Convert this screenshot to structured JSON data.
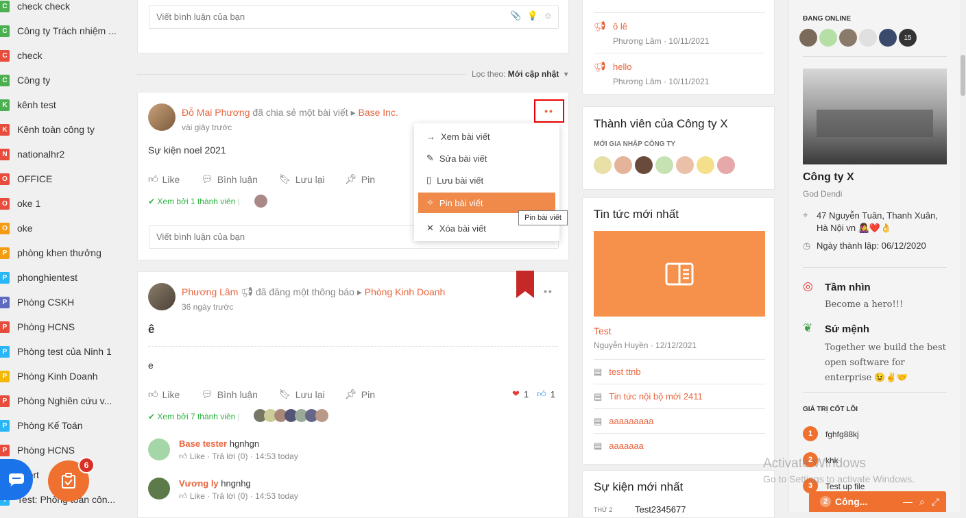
{
  "sidebar": {
    "items": [
      {
        "badge": "C",
        "color": "#4caf50",
        "label": "check check"
      },
      {
        "badge": "C",
        "color": "#4caf50",
        "label": "Công ty Trách nhiệm ..."
      },
      {
        "badge": "C",
        "color": "#e74c3c",
        "label": "check"
      },
      {
        "badge": "C",
        "color": "#4caf50",
        "label": "Công ty"
      },
      {
        "badge": "K",
        "color": "#4caf50",
        "label": "kênh test"
      },
      {
        "badge": "K",
        "color": "#e74c3c",
        "label": "Kênh toàn công ty"
      },
      {
        "badge": "N",
        "color": "#e74c3c",
        "label": "nationalhr2"
      },
      {
        "badge": "O",
        "color": "#e74c3c",
        "label": "OFFICE"
      },
      {
        "badge": "O",
        "color": "#e74c3c",
        "label": "oke 1"
      },
      {
        "badge": "O",
        "color": "#f39c12",
        "label": "oke"
      },
      {
        "badge": "P",
        "color": "#f39c12",
        "label": "phòng khen thưởng"
      },
      {
        "badge": "P",
        "color": "#29b6f6",
        "label": "phonghientest"
      },
      {
        "badge": "P",
        "color": "#5c6bc0",
        "label": "Phòng CSKH"
      },
      {
        "badge": "P",
        "color": "#e74c3c",
        "label": "Phòng HCNS"
      },
      {
        "badge": "P",
        "color": "#29b6f6",
        "label": "Phòng test của Ninh 1"
      },
      {
        "badge": "P",
        "color": "#f5b800",
        "label": "Phòng Kinh Doanh"
      },
      {
        "badge": "P",
        "color": "#e74c3c",
        "label": "Phòng Nghiên cứu v..."
      },
      {
        "badge": "P",
        "color": "#29b6f6",
        "label": "Phòng Kế Toán"
      },
      {
        "badge": "P",
        "color": "#e74c3c",
        "label": "Phòng HCNS"
      },
      {
        "badge": "P",
        "color": "#29b6f6",
        "label": "eport"
      },
      {
        "badge": "T",
        "color": "#29b6f6",
        "label": "Test: Phòng toàn côn..."
      }
    ],
    "notif_count": "6"
  },
  "feed": {
    "comment_placeholder": "Viết bình luận của bạn",
    "filter_label": "Lọc theo:",
    "filter_value": "Mới cập nhật",
    "post1": {
      "author": "Đỗ Mai Phương",
      "action": "đã chia sẻ một bài viết",
      "target": "Base Inc.",
      "time": "vài giây trước",
      "content": "Sự kiện noel 2021",
      "seen": "Xem bởi 1 thành viên"
    },
    "actions": {
      "like": "Like",
      "comment": "Bình luận",
      "save": "Lưu lại",
      "pin": "Pin"
    },
    "menu": {
      "items": [
        "Xem bài viết",
        "Sửa bài viết",
        "Lưu bài viết",
        "Pin bài viết",
        "Xóa bài viết"
      ],
      "tooltip": "Pin bài viết"
    },
    "post2": {
      "author": "Phương Lâm",
      "action": "đã đăng một thông báo",
      "target": "Phòng Kinh Doanh",
      "time": "36 ngày trước",
      "title": "ê",
      "body": "e",
      "hearts": "1",
      "likes": "1",
      "seen": "Xem bởi 7 thành viên",
      "comments": [
        {
          "author": "Base tester",
          "text": "hgnhgn",
          "meta_like": "Like",
          "meta": "· Trả lời (0) · 14:53 today"
        },
        {
          "author": "Vương ly",
          "text": "hngnhg",
          "meta_like": "Like",
          "meta": "· Trả lời (0) · 14:53 today"
        }
      ]
    }
  },
  "mid": {
    "notices": [
      {
        "title": "ô lê",
        "meta": "Phương Lâm · 10/11/2021"
      },
      {
        "title": "hello",
        "meta": "Phương Lâm · 10/11/2021"
      }
    ],
    "members_title": "Thành viên của Công ty X",
    "members_sub": "MỚI GIA NHẬP CÔNG TY",
    "news_title": "Tin tức mới nhất",
    "news_main_title": "Test",
    "news_main_meta": "Nguyễn Huyền · 12/12/2021",
    "news_list": [
      "test ttnb",
      "Tin tức nội bộ mới 2411",
      "aaaaaaaaa",
      "aaaaaaa"
    ],
    "events_title": "Sự kiện mới nhất",
    "event_day": "THỨ 2",
    "event_name": "Test2345677"
  },
  "right": {
    "online_label": "ĐANG ONLINE",
    "online_more": "15",
    "company_name": "Công ty X",
    "company_sub": "God Dendi",
    "address": "47 Nguyễn Tuân, Thanh Xuân, Hà Nội vn 👩‍🎤❤️👌",
    "founded": "Ngày thành lập: 06/12/2020",
    "vision_title": "Tầm nhìn",
    "vision_text": "Become a hero!!!",
    "mission_title": "Sứ mệnh",
    "mission_text": "Together we build the best open software for enterprise 😉✌️🤝",
    "values_title": "GIÁ TRỊ CỐT LÕI",
    "values": [
      {
        "n": "1",
        "t": "fghfg88kj"
      },
      {
        "n": "2",
        "t": "khk"
      },
      {
        "n": "3",
        "t": "Test up file"
      }
    ],
    "watermark1": "Activate Windows",
    "watermark2": "Go to Settings to activate Windows.",
    "chat_count": "2",
    "chat_label": "Công..."
  }
}
